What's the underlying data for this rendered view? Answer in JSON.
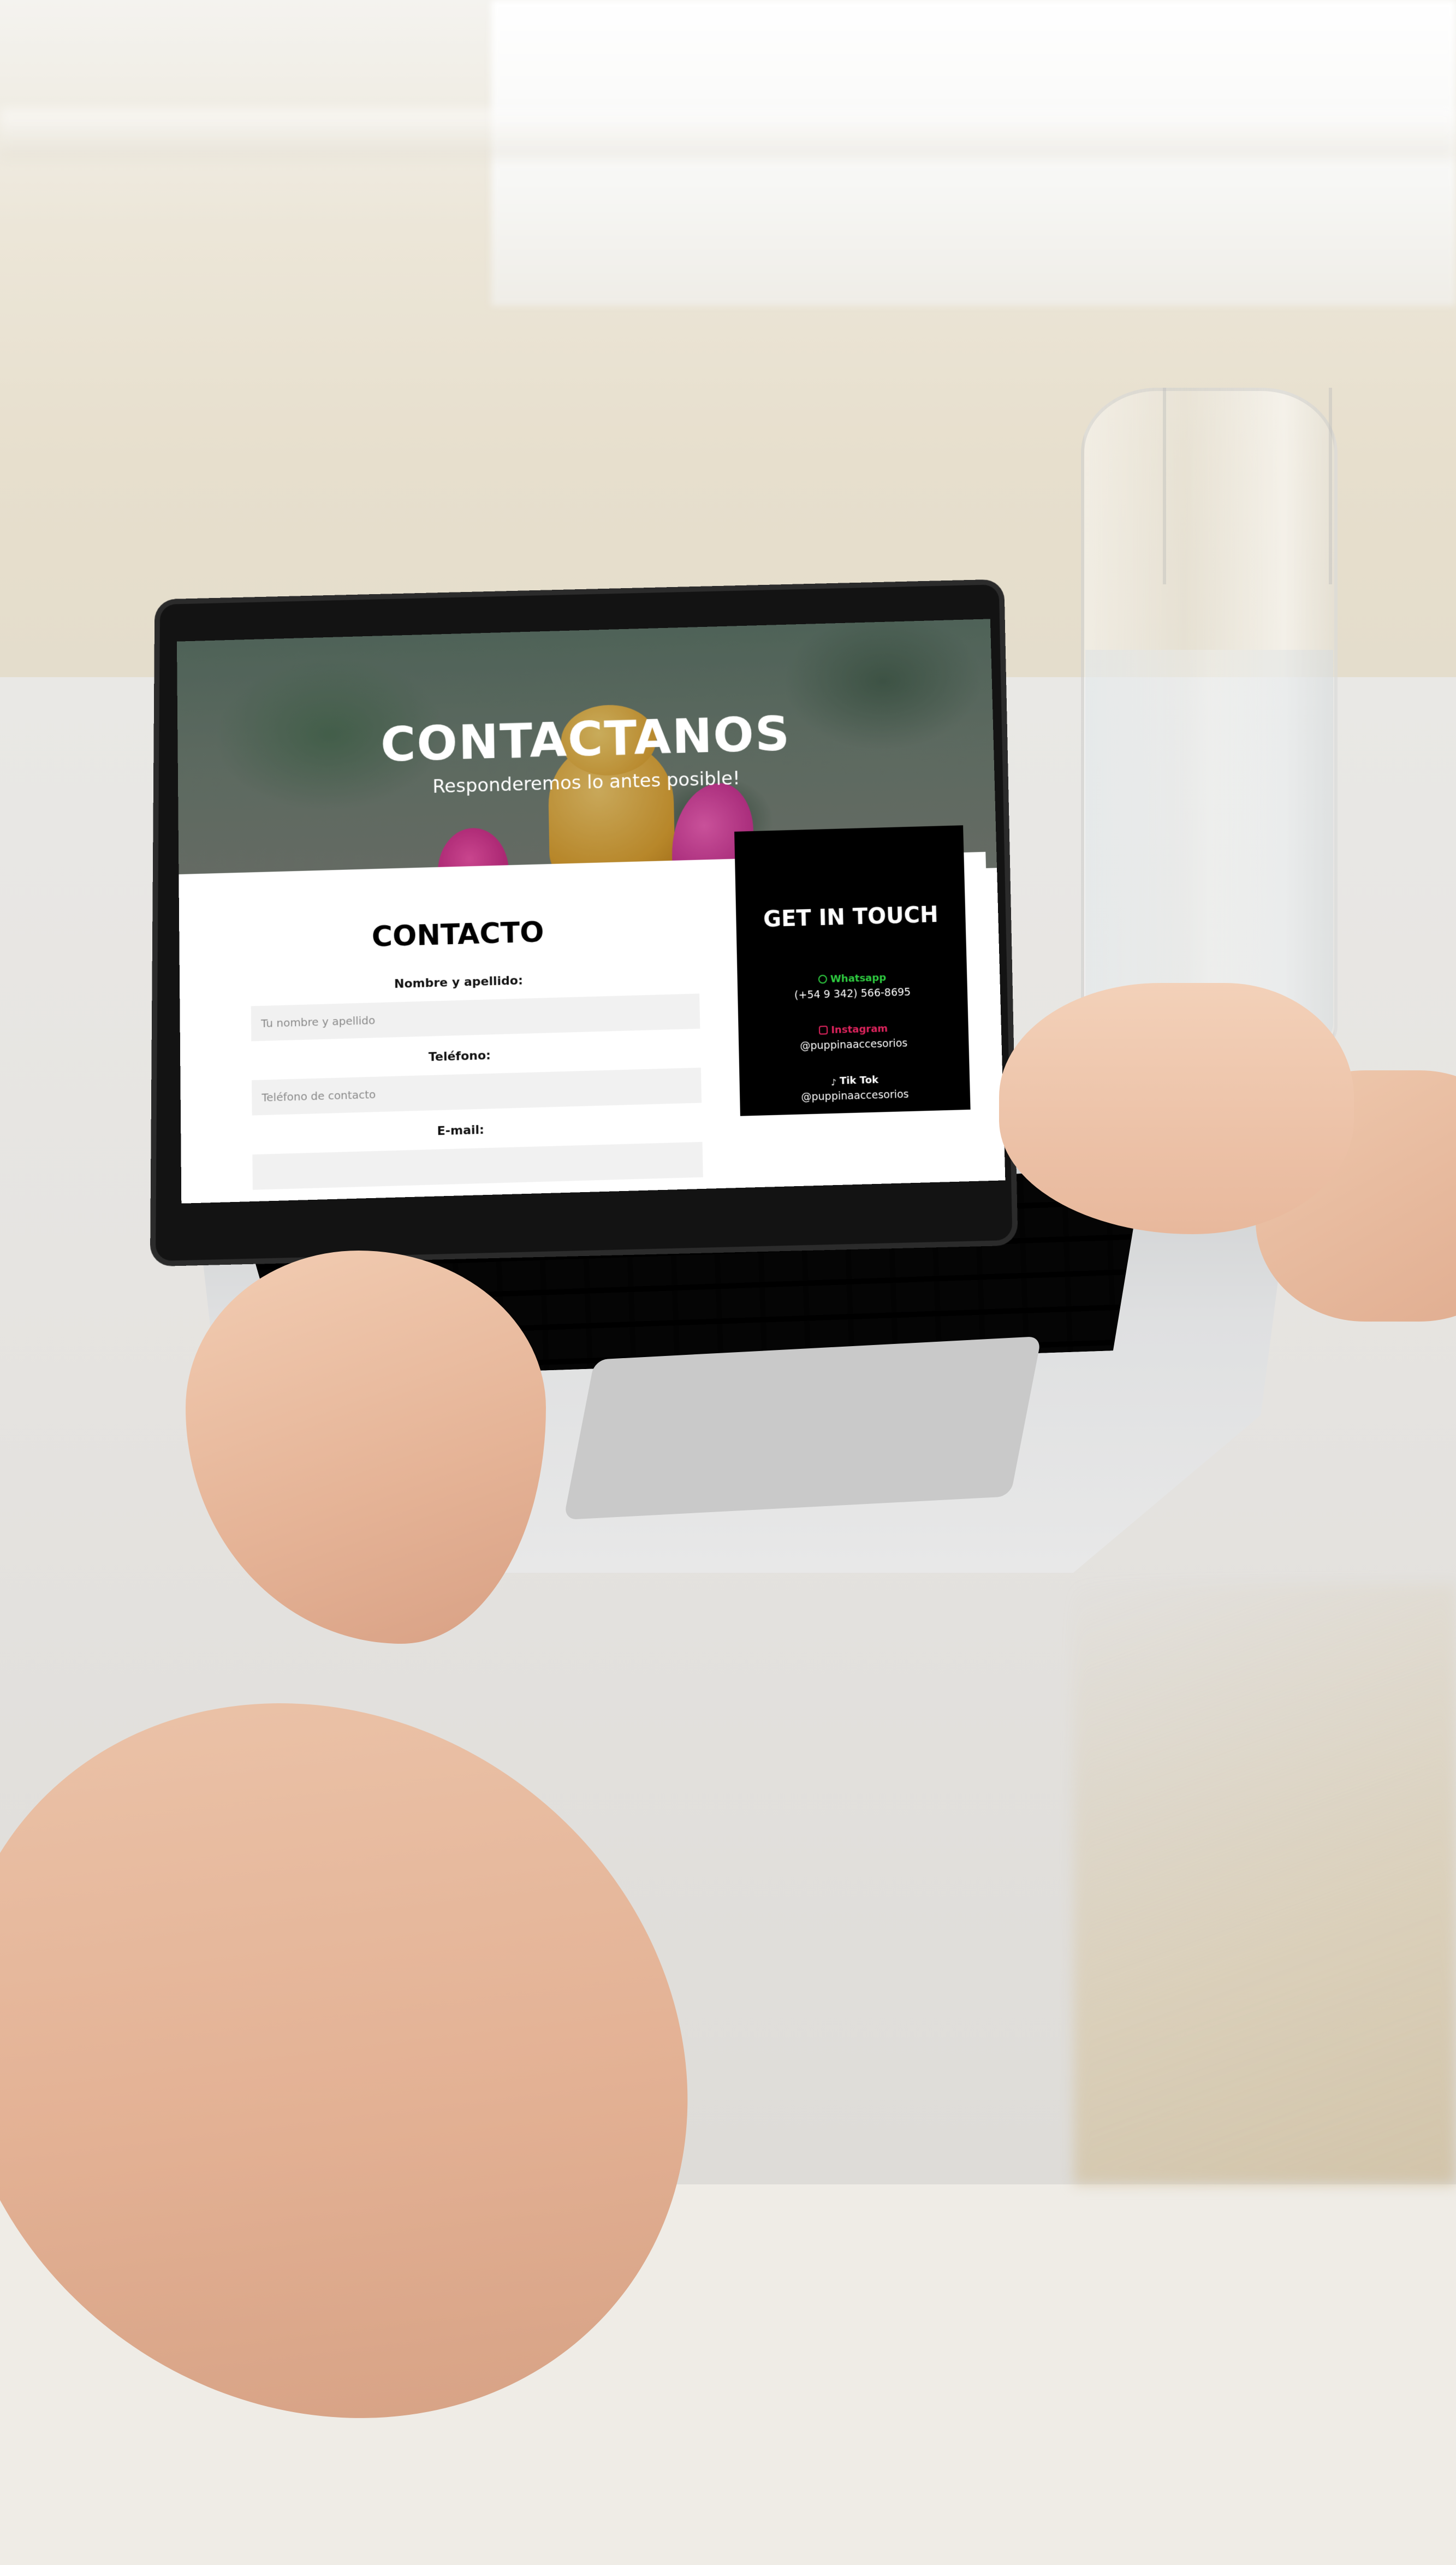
{
  "hero": {
    "title": "CONTACTANOS",
    "subtitle": "Responderemos lo antes posible!"
  },
  "form": {
    "title": "CONTACTO",
    "fields": [
      {
        "label": "Nombre y apellido:",
        "placeholder": "Tu nombre y apellido"
      },
      {
        "label": "Teléfono:",
        "placeholder": "Teléfono de contacto"
      },
      {
        "label": "E-mail:",
        "placeholder": ""
      }
    ]
  },
  "contact": {
    "title": "GET IN TOUCH",
    "items": [
      {
        "label": "Whatsapp",
        "value": "(+54 9 342) 566-8695",
        "color": "#2ecc40",
        "icon": "whatsapp-icon"
      },
      {
        "label": "Instagram",
        "value": "@puppinaaccesorios",
        "color": "#e0245e",
        "icon": "instagram-icon"
      },
      {
        "label": "Tik Tok",
        "value": "@puppinaaccesorios",
        "color": "#ffffff",
        "icon": "tiktok-icon"
      }
    ]
  },
  "colors": {
    "panel_bg": "#000000",
    "input_bg": "#f1f1f1"
  }
}
